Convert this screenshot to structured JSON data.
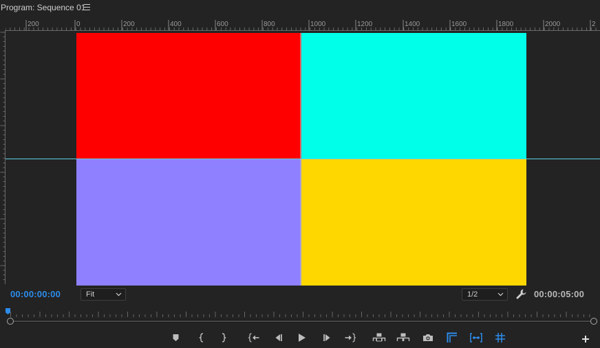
{
  "panel": {
    "title": "Program: Sequence 01",
    "menu_icon": "hamburger-menu-icon"
  },
  "ruler_horizontal": {
    "labels": [
      "200",
      "0",
      "200",
      "400",
      "600",
      "800",
      "1000",
      "1200",
      "1400",
      "1600",
      "1800",
      "2000",
      "2"
    ]
  },
  "video": {
    "colors": {
      "top_left": "#ff0000",
      "top_right": "#00ffe8",
      "bottom_left": "#8f80ff",
      "bottom_right": "#ffd700",
      "guide": "#5fd3e6"
    }
  },
  "timecode": {
    "current": "00:00:00:00",
    "duration": "00:00:05:00",
    "current_color": "#2d8ceb"
  },
  "zoom": {
    "selected": "Fit"
  },
  "resolution": {
    "selected": "1/2"
  },
  "settings": {
    "icon": "wrench-icon"
  },
  "transport": {
    "buttons": [
      {
        "name": "add-marker-button",
        "icon": "marker-icon"
      },
      {
        "name": "mark-in-button",
        "icon": "mark-in-icon"
      },
      {
        "name": "mark-out-button",
        "icon": "mark-out-icon"
      },
      {
        "name": "go-to-in-button",
        "icon": "go-to-in-icon"
      },
      {
        "name": "step-back-button",
        "icon": "step-back-icon"
      },
      {
        "name": "play-button",
        "icon": "play-icon"
      },
      {
        "name": "step-forward-button",
        "icon": "step-forward-icon"
      },
      {
        "name": "go-to-out-button",
        "icon": "go-to-out-icon"
      },
      {
        "name": "lift-button",
        "icon": "lift-icon"
      },
      {
        "name": "extract-button",
        "icon": "extract-icon"
      },
      {
        "name": "export-frame-button",
        "icon": "camera-icon"
      },
      {
        "name": "safe-margins-button",
        "icon": "safe-margins-icon",
        "active": true
      },
      {
        "name": "insert-edit-button",
        "icon": "insert-edit-icon",
        "active": true
      },
      {
        "name": "guides-button",
        "icon": "grid-icon",
        "active": true
      },
      {
        "name": "button-editor-button",
        "icon": "plus-icon"
      }
    ],
    "active_color": "#2d8ceb",
    "icon_color": "#bdbdbd"
  }
}
